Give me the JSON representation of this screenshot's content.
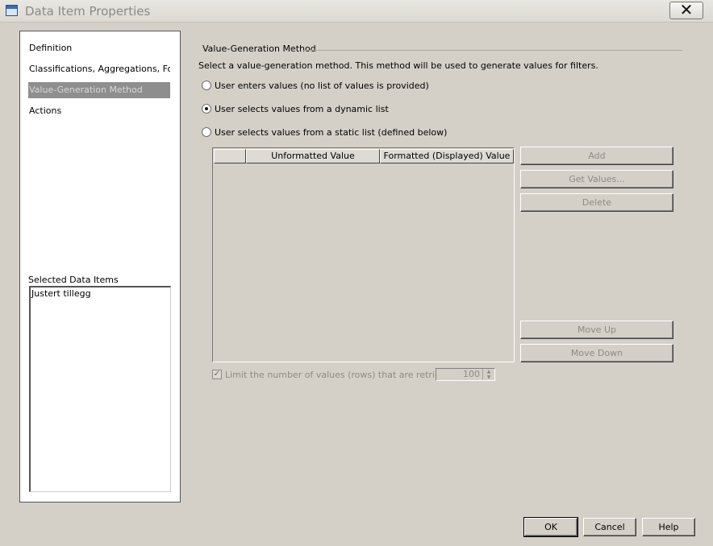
{
  "window": {
    "title": "Data Item Properties",
    "close_symbol": "✕",
    "app_icon": "dialog-icon"
  },
  "nav": {
    "items": [
      {
        "label": "Definition",
        "selected": false
      },
      {
        "label": "Classifications, Aggregations, For…",
        "selected": false
      },
      {
        "label": "Value-Generation Method",
        "selected": true
      },
      {
        "label": "Actions",
        "selected": false
      }
    ],
    "selected_items_label": "Selected Data Items",
    "selected_items": [
      "Justert tillegg"
    ]
  },
  "value_generation": {
    "group_title": "Value-Generation Method",
    "description": "Select a value-generation method.  This method will be used to generate values for filters.",
    "options": [
      {
        "label": "User enters values (no list of values is provided)",
        "checked": false
      },
      {
        "label": "User selects values from a dynamic list",
        "checked": true
      },
      {
        "label": "User selects values from a static list (defined below)",
        "checked": false
      }
    ]
  },
  "grid": {
    "columns": [
      "",
      "Unformatted Value",
      "Formatted (Displayed) Value"
    ],
    "rows": []
  },
  "side_buttons": {
    "add": "Add",
    "get_values": "Get Values...",
    "delete": "Delete",
    "move_up": "Move Up",
    "move_down": "Move Down"
  },
  "limit": {
    "label": "Limit the number of values (rows) that are retrieved:",
    "checked": true,
    "value": "100"
  },
  "footer": {
    "ok": "OK",
    "cancel": "Cancel",
    "help": "Help"
  }
}
